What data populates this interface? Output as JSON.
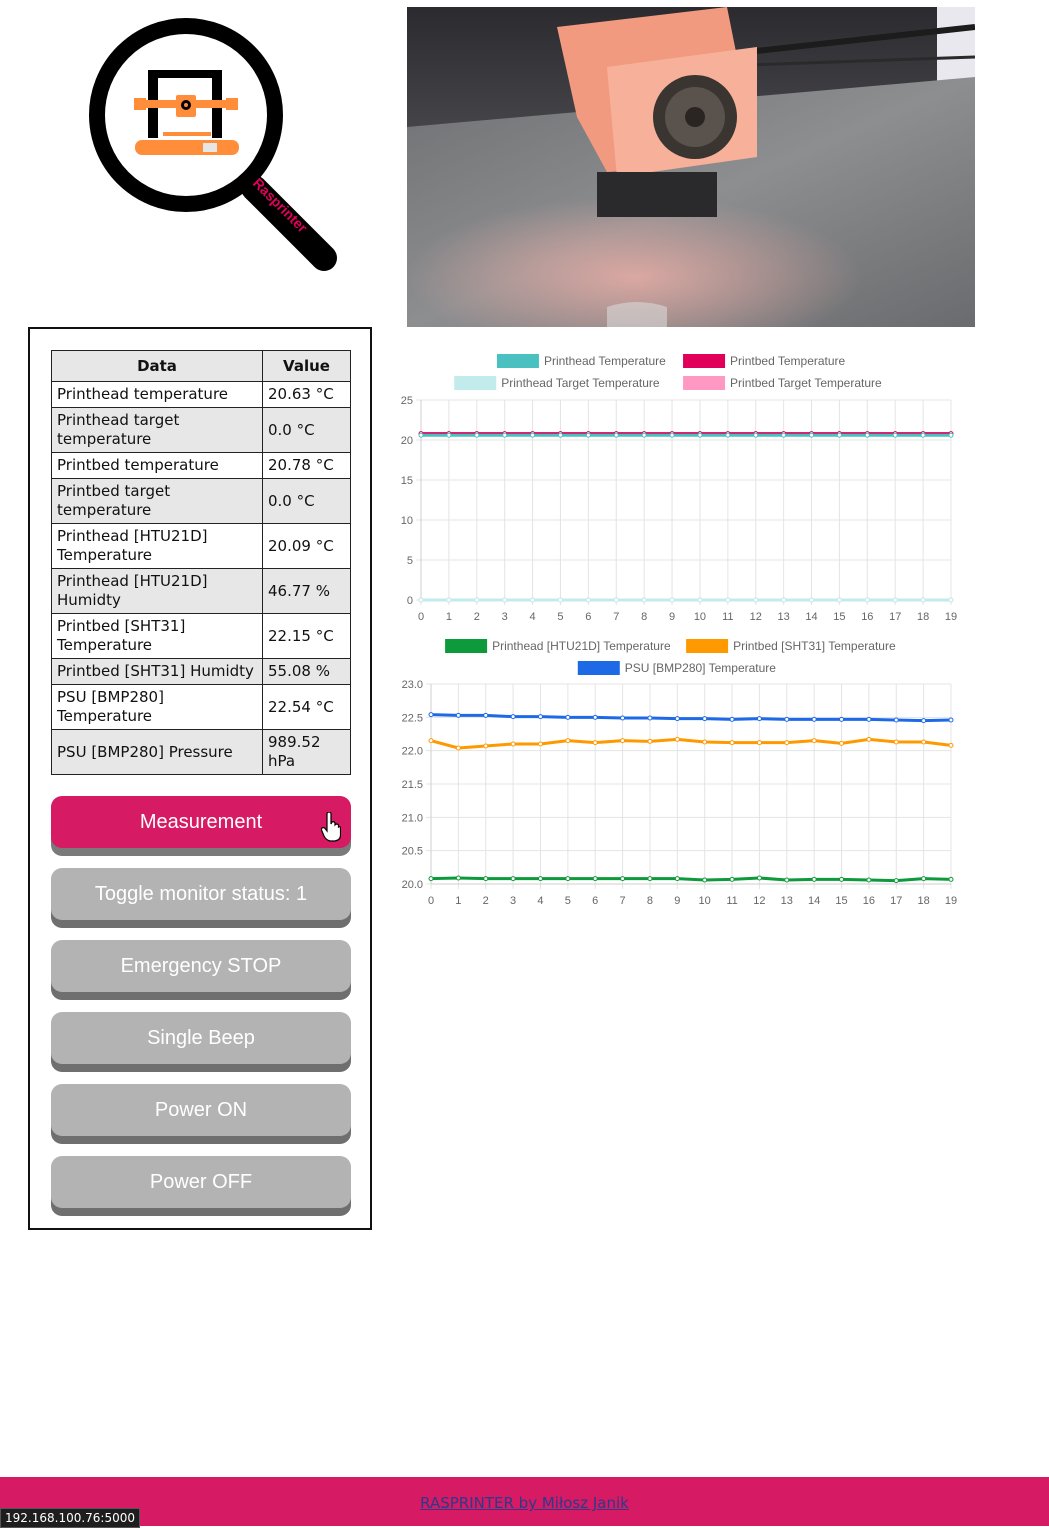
{
  "logo": {
    "text": "Rasprinter"
  },
  "camera": {
    "description_icon": "camera-feed"
  },
  "table": {
    "headers": [
      "Data",
      "Value"
    ],
    "rows": [
      [
        "Printhead temperature",
        "20.63 °C"
      ],
      [
        "Printhead target temperature",
        "0.0 °C"
      ],
      [
        "Printbed temperature",
        "20.78 °C"
      ],
      [
        "Printbed target temperature",
        "0.0 °C"
      ],
      [
        "Printhead [HTU21D] Temperature",
        "20.09 °C"
      ],
      [
        "Printhead [HTU21D] Humidty",
        "46.77 %"
      ],
      [
        "Printbed [SHT31] Temperature",
        "22.15 °C"
      ],
      [
        "Printbed [SHT31] Humidty",
        "55.08 %"
      ],
      [
        "PSU [BMP280] Temperature",
        "22.54 °C"
      ],
      [
        "PSU [BMP280] Pressure",
        "989.52 hPa"
      ]
    ]
  },
  "buttons": {
    "measurement": "Measurement",
    "toggle_monitor": "Toggle monitor status: 1",
    "emergency_stop": "Emergency STOP",
    "single_beep": "Single Beep",
    "power_on": "Power ON",
    "power_off": "Power OFF"
  },
  "colors": {
    "accent": "#d61a63",
    "button_gray": "#b3b3b3"
  },
  "chart_data": [
    {
      "type": "line",
      "x": [
        0,
        1,
        2,
        3,
        4,
        5,
        6,
        7,
        8,
        9,
        10,
        11,
        12,
        13,
        14,
        15,
        16,
        17,
        18,
        19
      ],
      "ylim": [
        0,
        25
      ],
      "yticks": [
        0,
        5,
        10,
        15,
        20,
        25
      ],
      "grid": true,
      "legend": "top",
      "series": [
        {
          "name": "Printhead Temperature",
          "color": "#4bc0c0",
          "values": [
            20.6,
            20.6,
            20.6,
            20.6,
            20.6,
            20.6,
            20.6,
            20.6,
            20.6,
            20.6,
            20.6,
            20.6,
            20.6,
            20.6,
            20.6,
            20.6,
            20.6,
            20.6,
            20.6,
            20.6
          ]
        },
        {
          "name": "Printbed Temperature",
          "color": "#e0005a",
          "values": [
            20.8,
            20.8,
            20.8,
            20.8,
            20.8,
            20.8,
            20.8,
            20.8,
            20.8,
            20.8,
            20.8,
            20.8,
            20.8,
            20.8,
            20.8,
            20.8,
            20.8,
            20.8,
            20.8,
            20.8
          ]
        },
        {
          "name": "Printhead Target Temperature",
          "color": "#c2ecec",
          "values": [
            0,
            0,
            0,
            0,
            0,
            0,
            0,
            0,
            0,
            0,
            0,
            0,
            0,
            0,
            0,
            0,
            0,
            0,
            0,
            0
          ]
        },
        {
          "name": "Printbed Target Temperature",
          "color": "#ff99c4",
          "values": [
            0,
            0,
            0,
            0,
            0,
            0,
            0,
            0,
            0,
            0,
            0,
            0,
            0,
            0,
            0,
            0,
            0,
            0,
            0,
            0
          ]
        }
      ]
    },
    {
      "type": "line",
      "x": [
        0,
        1,
        2,
        3,
        4,
        5,
        6,
        7,
        8,
        9,
        10,
        11,
        12,
        13,
        14,
        15,
        16,
        17,
        18,
        19
      ],
      "ylim": [
        20.0,
        23.0
      ],
      "yticks": [
        "20.0",
        "20.5",
        "21.0",
        "21.5",
        "22.0",
        "22.5",
        "23.0"
      ],
      "grid": true,
      "legend": "top",
      "series": [
        {
          "name": "Printhead [HTU21D] Temperature",
          "color": "#0d9a3a",
          "values": [
            20.08,
            20.09,
            20.08,
            20.08,
            20.08,
            20.08,
            20.08,
            20.08,
            20.08,
            20.08,
            20.06,
            20.07,
            20.09,
            20.06,
            20.07,
            20.07,
            20.06,
            20.05,
            20.08,
            20.07
          ]
        },
        {
          "name": "Printbed [SHT31] Temperature",
          "color": "#ff9900",
          "values": [
            22.15,
            22.04,
            22.07,
            22.1,
            22.1,
            22.15,
            22.12,
            22.15,
            22.14,
            22.17,
            22.13,
            22.12,
            22.12,
            22.12,
            22.15,
            22.11,
            22.17,
            22.13,
            22.13,
            22.08
          ]
        },
        {
          "name": "PSU [BMP280] Temperature",
          "color": "#1e6ae6",
          "values": [
            22.54,
            22.53,
            22.53,
            22.51,
            22.51,
            22.5,
            22.5,
            22.49,
            22.49,
            22.48,
            22.48,
            22.47,
            22.48,
            22.47,
            22.47,
            22.47,
            22.47,
            22.46,
            22.45,
            22.46
          ]
        }
      ]
    }
  ],
  "footer": {
    "link_text": "RASPRINTER by Miłosz Janik"
  },
  "status_bar": {
    "url": "192.168.100.76:5000"
  }
}
